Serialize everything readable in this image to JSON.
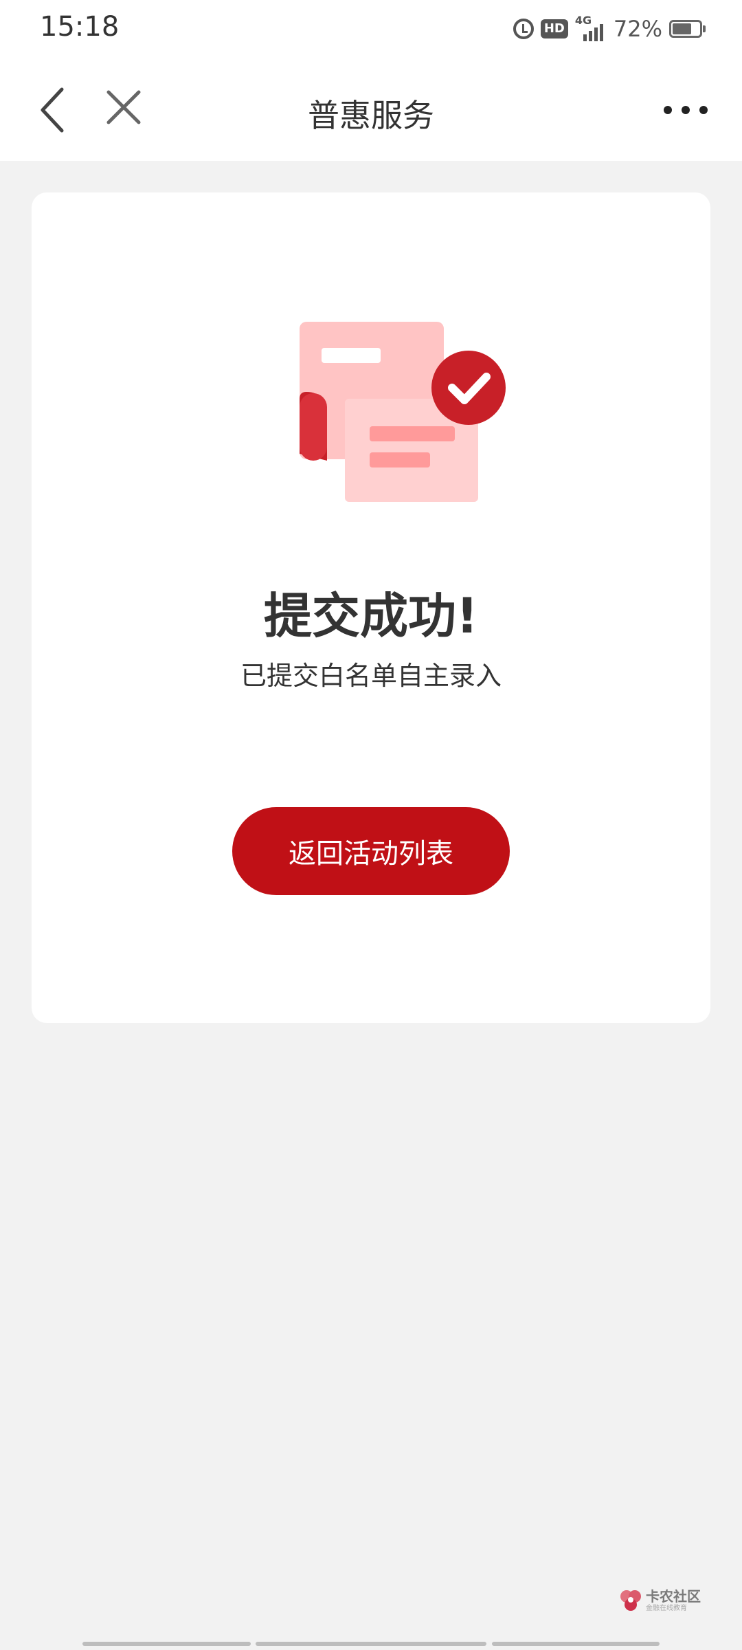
{
  "status_bar": {
    "time": "15:18",
    "hd_label": "HD",
    "network": "4G",
    "battery_percent_text": "72%",
    "battery_level": 0.72
  },
  "navbar": {
    "title": "普惠服务"
  },
  "result": {
    "title": "提交成功!",
    "subtitle": "已提交白名单自主录入",
    "button_label": "返回活动列表"
  },
  "watermark": {
    "main": "卡农社区",
    "sub": "金融在线教育"
  },
  "colors": {
    "accent": "#c01016",
    "illus_light": "#ffc4c4",
    "illus_mid": "#ff9a9a",
    "illus_dark": "#c82028"
  }
}
